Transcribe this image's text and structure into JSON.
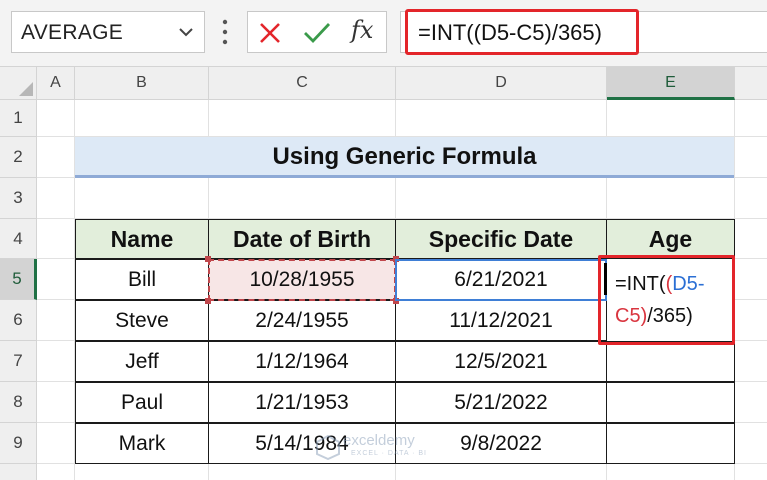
{
  "formula_bar": {
    "name_box": "AVERAGE",
    "cancel_icon": "x-icon",
    "enter_icon": "check-icon",
    "fx_label": "fx",
    "formula": "=INT((D5-C5)/365)"
  },
  "grid": {
    "column_headers": [
      "A",
      "B",
      "C",
      "D",
      "E"
    ],
    "row_headers": [
      "1",
      "2",
      "3",
      "4",
      "5",
      "6",
      "7",
      "8",
      "9"
    ],
    "selected_column": "E",
    "selected_row": "5"
  },
  "sheet": {
    "title": "Using Generic Formula",
    "table_headers": [
      "Name",
      "Date of Birth",
      "Specific Date",
      "Age"
    ],
    "rows": [
      {
        "name": "Bill",
        "dob": "10/28/1955",
        "specific": "6/21/2021"
      },
      {
        "name": "Steve",
        "dob": "2/24/1955",
        "specific": "11/12/2021"
      },
      {
        "name": "Jeff",
        "dob": "1/12/1964",
        "specific": "12/5/2021"
      },
      {
        "name": "Paul",
        "dob": "1/21/1953",
        "specific": "5/21/2022"
      },
      {
        "name": "Mark",
        "dob": "5/14/1984",
        "specific": "9/8/2022"
      }
    ],
    "age_edit": {
      "prefix": "=INT(",
      "paren": "(",
      "d5": "D5",
      "minus": "-",
      "c5": "C5",
      "close": ")",
      "suffix": "/365)"
    }
  },
  "watermark": {
    "text": "exceldemy",
    "sub": "EXCEL · DATA · BI"
  },
  "colors": {
    "accent_red": "#e3252a",
    "excel_green": "#1f7145",
    "ref_blue": "#2b6fd4",
    "ref_red": "#d9353f"
  }
}
